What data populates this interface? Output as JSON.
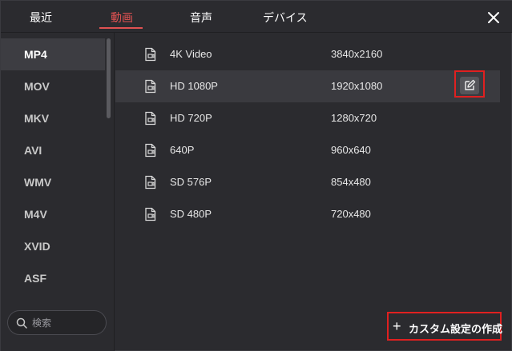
{
  "tabs": {
    "recent": "最近",
    "video": "動画",
    "audio": "音声",
    "device": "デバイス"
  },
  "formats": [
    "MP4",
    "MOV",
    "MKV",
    "AVI",
    "WMV",
    "M4V",
    "XVID",
    "ASF"
  ],
  "search": {
    "placeholder": "検索"
  },
  "presets": [
    {
      "name": "4K Video",
      "resolution": "3840x2160"
    },
    {
      "name": "HD 1080P",
      "resolution": "1920x1080"
    },
    {
      "name": "HD 720P",
      "resolution": "1280x720"
    },
    {
      "name": "640P",
      "resolution": "960x640"
    },
    {
      "name": "SD 576P",
      "resolution": "854x480"
    },
    {
      "name": "SD 480P",
      "resolution": "720x480"
    }
  ],
  "custom_button": {
    "plus": "+",
    "label": "カスタム設定の作成"
  },
  "colors": {
    "accent": "#e05252",
    "highlight": "#e02020",
    "background": "#2b2b2f"
  }
}
